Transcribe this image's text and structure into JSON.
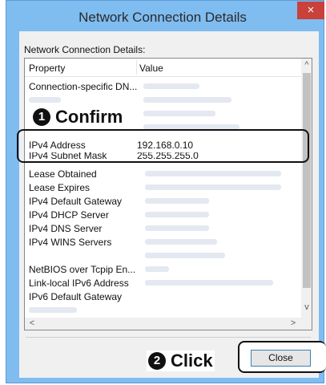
{
  "window": {
    "title": "Network Connection Details",
    "close_glyph": "×",
    "title_bar_color": "#7fbcf0"
  },
  "list": {
    "caption": "Network Connection Details:",
    "columns": {
      "property": "Property",
      "value": "Value"
    },
    "rows": [
      {
        "property": "Connection-specific DN...",
        "value": ""
      },
      {
        "property": "IPv4 Address",
        "value": "192.168.0.10"
      },
      {
        "property": "IPv4 Subnet Mask",
        "value": "255.255.255.0"
      },
      {
        "property": "Lease Obtained",
        "value": ""
      },
      {
        "property": "Lease Expires",
        "value": ""
      },
      {
        "property": "IPv4 Default Gateway",
        "value": ""
      },
      {
        "property": "IPv4 DHCP Server",
        "value": ""
      },
      {
        "property": "IPv4 DNS Server",
        "value": ""
      },
      {
        "property": "IPv4 WINS Servers",
        "value": ""
      },
      {
        "property": "NetBIOS over Tcpip En...",
        "value": ""
      },
      {
        "property": "Link-local IPv6 Address",
        "value": ""
      },
      {
        "property": "IPv6 Default Gateway",
        "value": ""
      }
    ]
  },
  "scroll": {
    "up": "^",
    "down": "v",
    "left": "<",
    "right": ">"
  },
  "callouts": {
    "confirm_number": "1",
    "confirm_text": "Confirm",
    "click_number": "2",
    "click_text": "Click"
  },
  "buttons": {
    "close": "Close"
  },
  "colors": {
    "close_button_border": "#3c7fb1",
    "title_close_bg": "#c9413a"
  }
}
